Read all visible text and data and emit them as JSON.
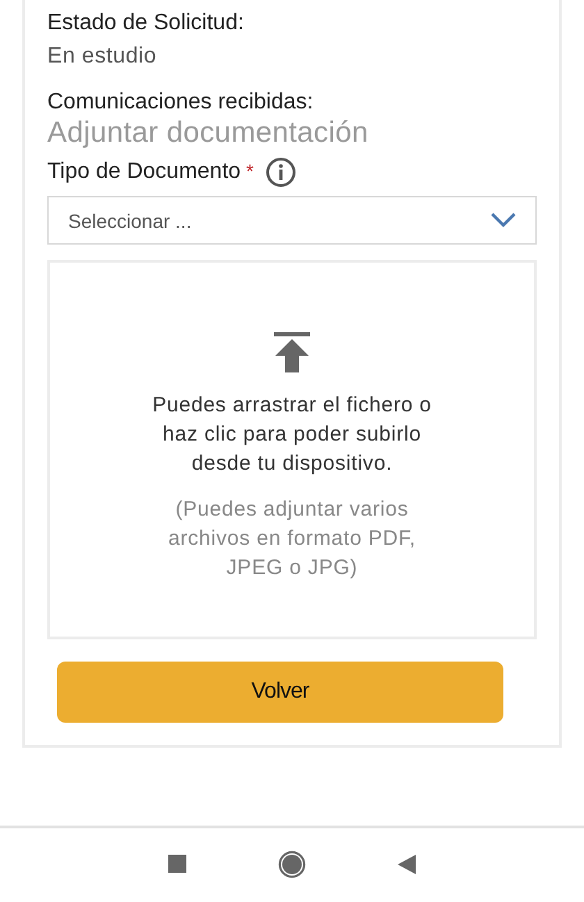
{
  "status": {
    "label": "Estado de Solicitud:",
    "value": "En estudio"
  },
  "communications": {
    "label": "Comunicaciones recibidas:"
  },
  "section_title": "Adjuntar documentación",
  "document_type": {
    "label": "Tipo de Documento",
    "required_mark": "*",
    "placeholder": "Seleccionar ..."
  },
  "dropzone": {
    "instructions": "Puedes arrastrar el fichero o haz clic para poder subirlo desde tu dispositivo.",
    "note": "(Puedes adjuntar varios archivos en formato PDF, JPEG o JPG)"
  },
  "buttons": [
    "Volver"
  ]
}
